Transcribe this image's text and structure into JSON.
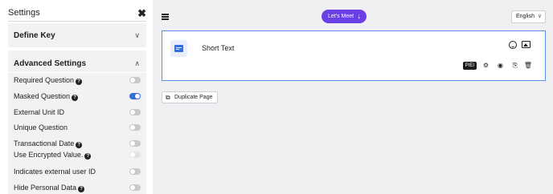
{
  "sidebar": {
    "title": "Settings",
    "close_icon": "close-icon",
    "define_key": {
      "label": "Define Key",
      "chevron": "chevron-down-icon"
    },
    "advanced": {
      "label": "Advanced Settings",
      "chevron": "chevron-up-icon",
      "rows": [
        {
          "label": "Required Question",
          "help": true,
          "enabled": false
        },
        {
          "label": "Masked Question",
          "help": true,
          "enabled": true
        },
        {
          "label": "External Unit ID",
          "help": false,
          "enabled": false
        },
        {
          "label": "Unique Question",
          "help": false,
          "enabled": false
        },
        {
          "label": "Transactional Date",
          "help": true,
          "enabled": false
        },
        {
          "label": "Use Encrypted Value.",
          "help": true,
          "enabled": false,
          "disabled": true
        },
        {
          "label": "Indicates external user ID",
          "help": false,
          "enabled": false
        },
        {
          "label": "Hide Personal Data",
          "help": true,
          "enabled": false
        }
      ]
    }
  },
  "header": {
    "menu_icon": "hamburger-menu-icon",
    "meet_button": "Let's Meet",
    "meet_icon": "microphone-icon",
    "language": "English"
  },
  "question_card": {
    "title": "Short Text",
    "type_icon": "short-text-icon",
    "pii_badge": "PIEI",
    "icons": [
      "emoji-icon",
      "image-icon",
      "gear-icon",
      "eye-icon",
      "copy-icon",
      "trash-icon"
    ]
  },
  "duplicate_page": {
    "label": "Duplicate Page",
    "icon": "duplicate-icon"
  },
  "colors": {
    "accent": "#6a3fe6",
    "toggle_on": "#2f6fe0",
    "card_border": "#5b8ee8",
    "panel_bg": "#f2f2f4",
    "canvas_bg": "#f0f0f2"
  }
}
